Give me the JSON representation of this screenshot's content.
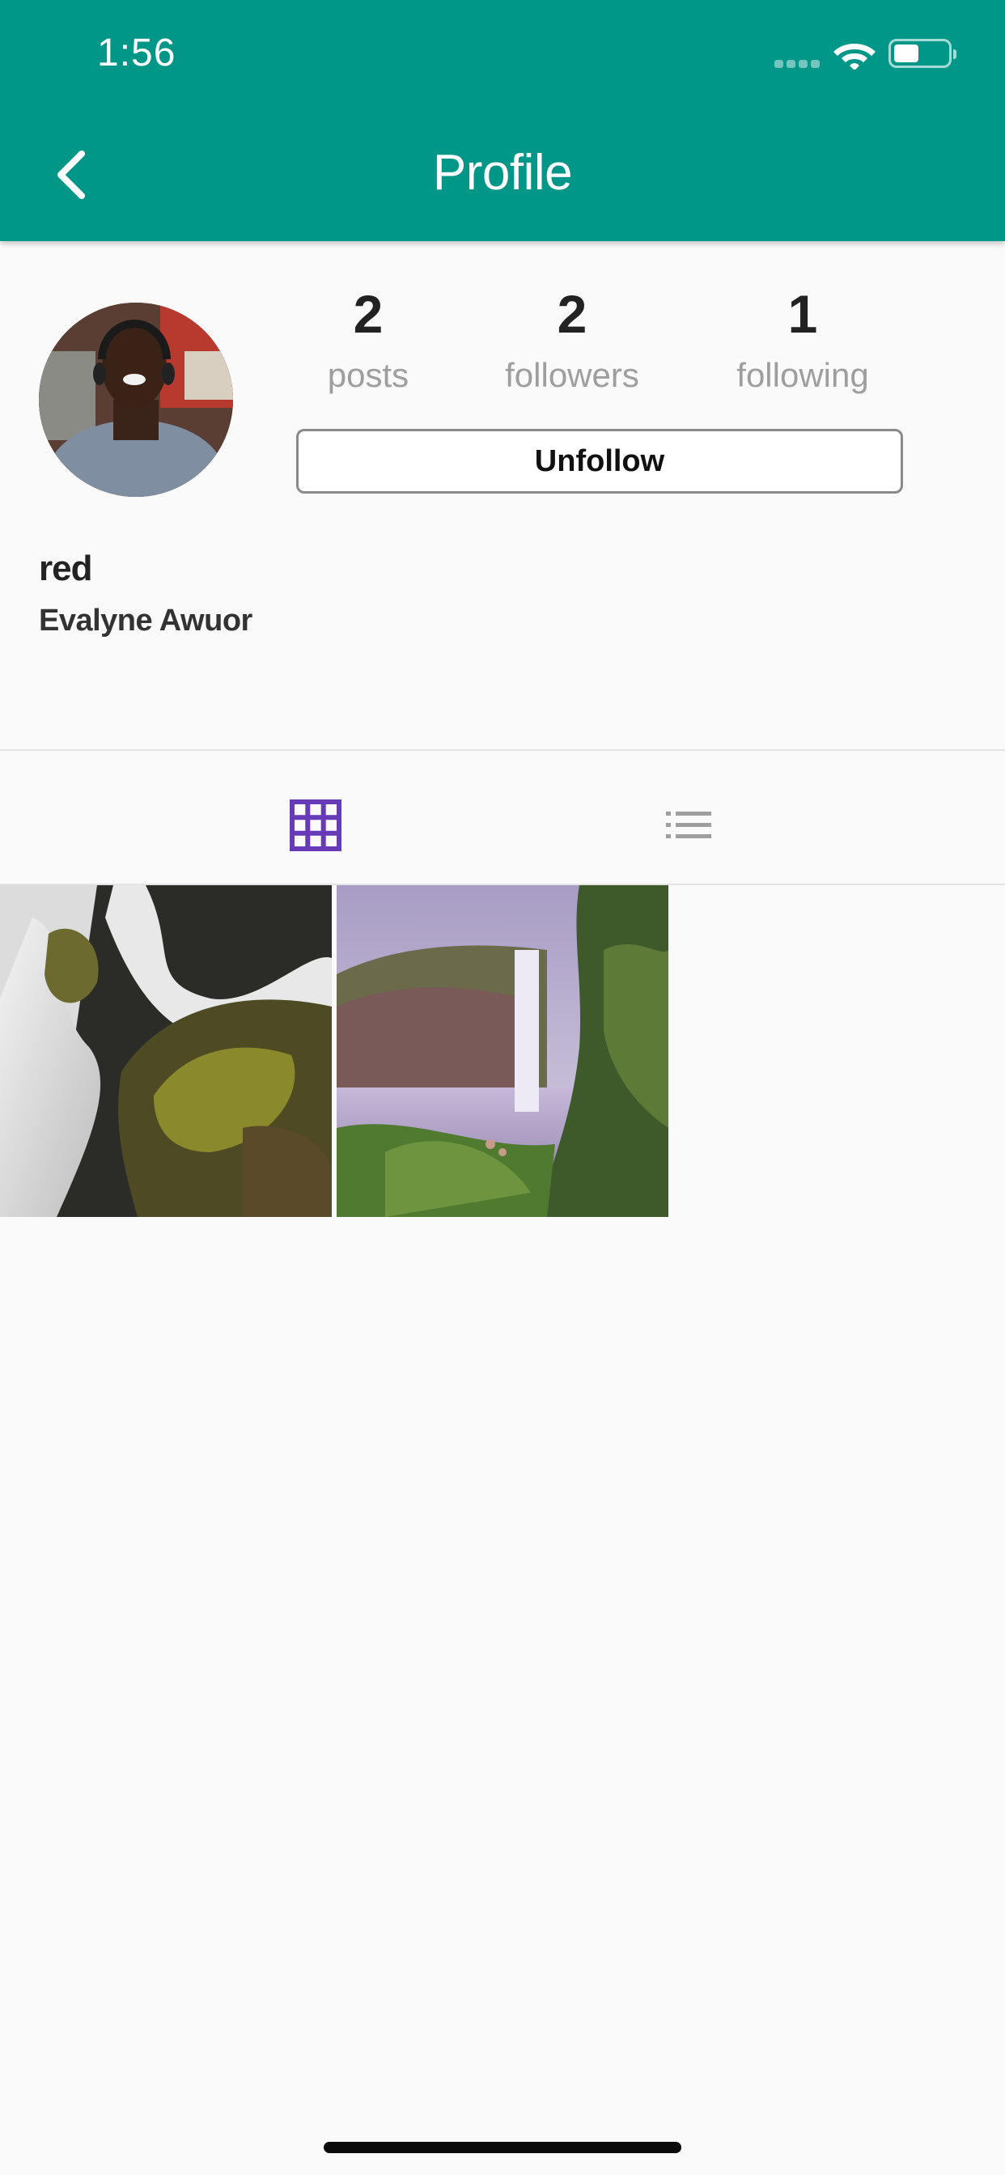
{
  "status_bar": {
    "time": "1:56"
  },
  "header": {
    "title": "Profile",
    "back_icon": "chevron-left-icon",
    "background_color": "#009688"
  },
  "profile": {
    "username": "red",
    "full_name": "Evalyne Awuor",
    "stats": [
      {
        "value": "2",
        "label": "posts"
      },
      {
        "value": "2",
        "label": "followers"
      },
      {
        "value": "1",
        "label": "following"
      }
    ],
    "action_button_label": "Unfollow"
  },
  "tabs": [
    {
      "icon": "grid-icon",
      "active": true,
      "color": "#673ab7"
    },
    {
      "icon": "list-icon",
      "active": false,
      "color": "#9e9e9e"
    }
  ],
  "posts": [
    {
      "subject": "waterfall over mossy rocks"
    },
    {
      "subject": "waterfall in green valley"
    }
  ]
}
